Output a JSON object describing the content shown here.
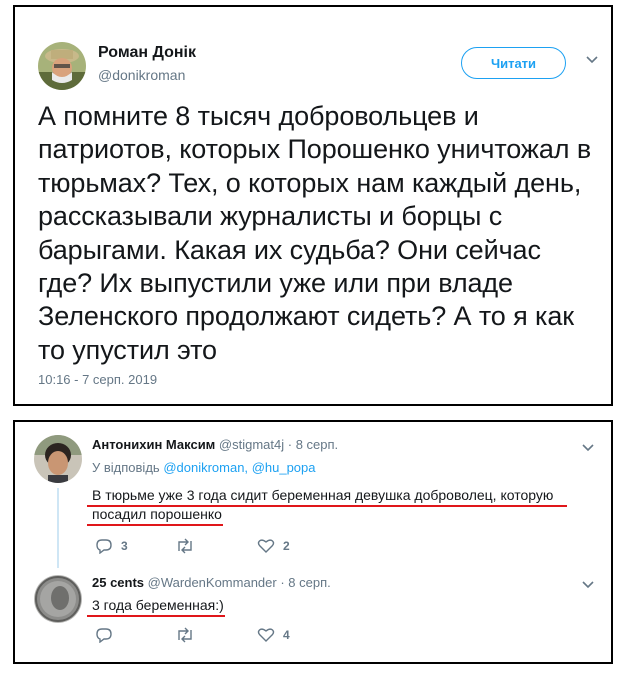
{
  "tweet": {
    "author_name": "Роман Донік",
    "author_handle": "@donikroman",
    "follow_label": "Читати",
    "text": "А помните 8 тысяч добровольцев и патриотов, которых Порошенко уничтожал в тюрьмах? Тех, о которых нам каждый день, рассказывали журналисты и борцы с барыгами. Какая их судьба? Они сейчас где? Их выпустили уже или при владе Зеленского продолжают сидеть? А то я как то упустил это",
    "timestamp": "10:16 - 7 серп. 2019"
  },
  "replies": [
    {
      "author_name": "Антонихин Максим",
      "author_handle": "@stigmat4j",
      "date": "· 8 серп.",
      "reply_to_label": "У відповідь",
      "reply_to_1": "@donikroman,",
      "reply_to_2": "@hu_popa",
      "text_line1": "В тюрьме уже 3 года сидит беременная девушка доброволец, которую",
      "text_line2": "посадил порошенко",
      "replies_count": "3",
      "retweets_count": "",
      "likes_count": "2"
    },
    {
      "author_name": "25 cents",
      "author_handle": "@WardenKommander",
      "date": "· 8 серп.",
      "text_line1": "3 года беременная:)",
      "replies_count": "",
      "retweets_count": "",
      "likes_count": "4"
    }
  ],
  "colors": {
    "accent": "#1da1f2",
    "muted": "#657786",
    "underline": "#e0161a",
    "border": "#000000"
  },
  "icons": [
    "chevron-down-icon",
    "reply-icon",
    "retweet-icon",
    "heart-icon"
  ]
}
